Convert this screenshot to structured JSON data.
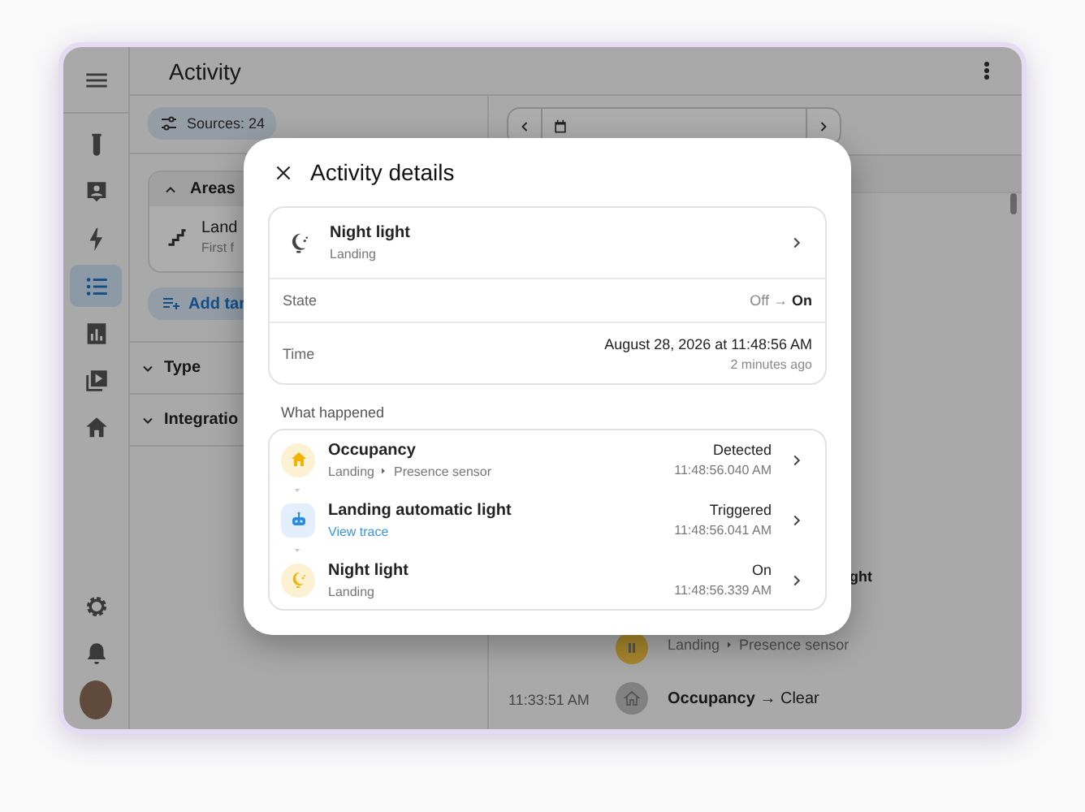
{
  "app_bar": {
    "title": "Activity"
  },
  "sidebar": {
    "items": [
      {
        "selected": false
      },
      {
        "selected": false
      },
      {
        "selected": false
      },
      {
        "selected": true
      },
      {
        "selected": false
      },
      {
        "selected": false
      },
      {
        "selected": false
      }
    ],
    "footer_items": [
      {
        "selected": false
      },
      {
        "selected": false
      }
    ]
  },
  "filters": {
    "sources": "Sources: 24",
    "areas": {
      "title": "Areas",
      "expanded": true,
      "items": [
        {
          "name": "Land",
          "floor": "First f"
        }
      ]
    },
    "add_target": "Add tar",
    "sections": [
      {
        "title": "Type",
        "expanded": false
      },
      {
        "title": "Integratio",
        "expanded": false
      }
    ]
  },
  "timeline": {
    "entries": [
      {
        "kind": "title_only",
        "name": "ght"
      },
      {
        "kind": "subtitle_only",
        "area": "Landing",
        "device": "Presence sensor",
        "color": "#a7862d"
      },
      {
        "kind": "full",
        "time": "11:33:51 AM",
        "name": "Occupancy",
        "arrow": "→",
        "state": "Clear",
        "color": "#818181"
      }
    ]
  },
  "dialog": {
    "title": "Activity details",
    "entity": {
      "name": "Night light",
      "area": "Landing"
    },
    "state": {
      "label": "State",
      "from": "Off",
      "arrow": "→",
      "to": "On"
    },
    "time": {
      "label": "Time",
      "value": "August 28, 2026 at 11:48:56 AM",
      "relative": "2 minutes ago"
    },
    "what_happened": {
      "title": "What happened",
      "events": [
        {
          "kind": "sensor",
          "name": "Occupancy",
          "area": "Landing",
          "device": "Presence sensor",
          "status": "Detected",
          "time": "11:48:56.040 AM"
        },
        {
          "kind": "automation",
          "name": "Landing automatic light",
          "link": "View trace",
          "status": "Triggered",
          "time": "11:48:56.041 AM"
        },
        {
          "kind": "light",
          "name": "Night light",
          "area": "Landing",
          "status": "On",
          "time": "11:48:56.339 AM"
        }
      ]
    }
  }
}
